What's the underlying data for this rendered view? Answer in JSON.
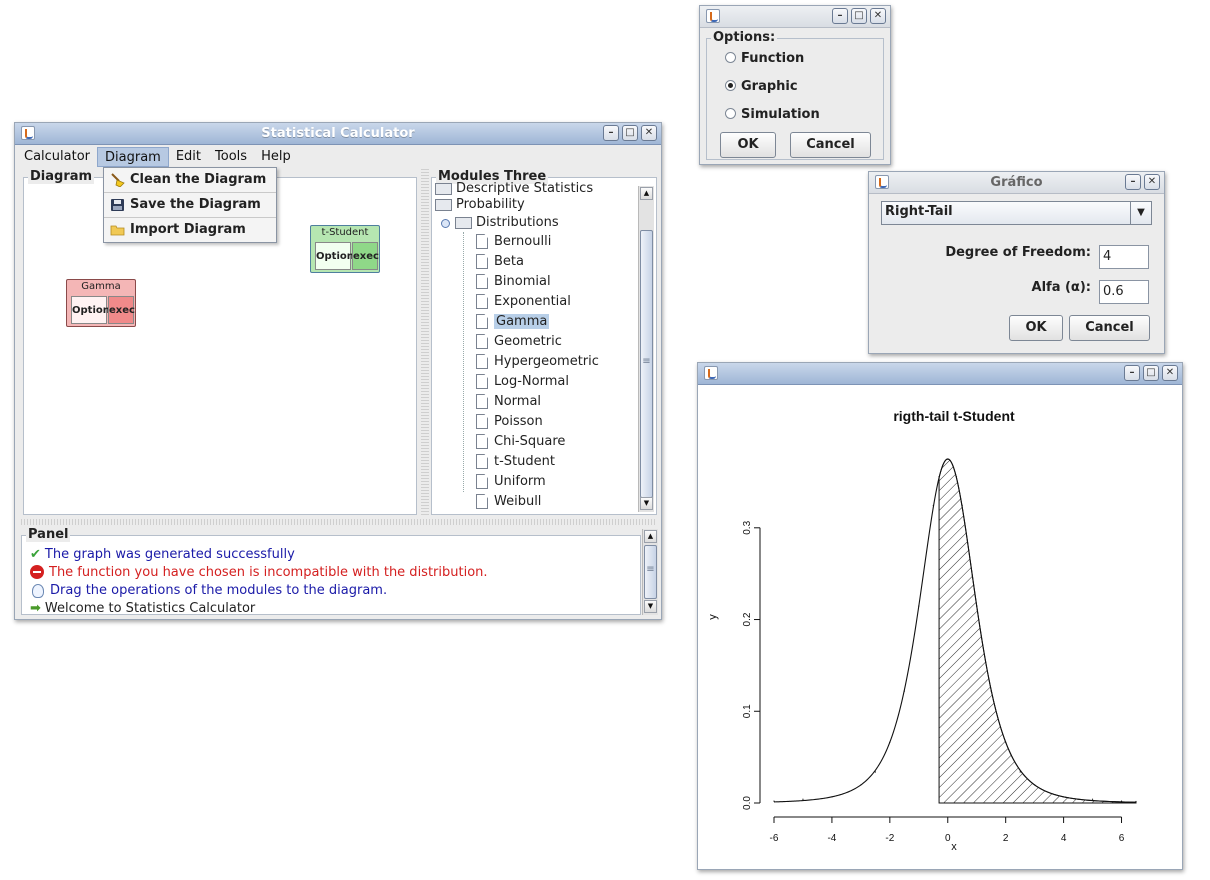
{
  "main_window": {
    "title": "Statistical Calculator",
    "menus": [
      "Calculator",
      "Diagram",
      "Edit",
      "Tools",
      "Help"
    ],
    "active_menu": "Diagram",
    "diagram_menu_items": [
      {
        "label": "Clean the Diagram",
        "icon": "broom-icon"
      },
      {
        "label": "Save the Diagram",
        "icon": "floppy-disk-icon"
      },
      {
        "label": "Import Diagram",
        "icon": "folder-icon"
      }
    ],
    "diagram_panel_title": "Diagram",
    "nodes": [
      {
        "title": "t-Student",
        "option_label": "Option",
        "exec_label": "exec",
        "color": "#b6e6b1"
      },
      {
        "title": "Gamma",
        "option_label": "Option",
        "exec_label": "exec",
        "color": "#f4b6b6"
      }
    ],
    "modules_title": "Modules Three",
    "tree": {
      "partial_item": "Descriptive Statistics",
      "probability": "Probability",
      "distributions": "Distributions",
      "items": [
        "Bernoulli",
        "Beta",
        "Binomial",
        "Exponential",
        "Gamma",
        "Geometric",
        "Hypergeometric",
        "Log-Normal",
        "Normal",
        "Poisson",
        "Chi-Square",
        "t-Student",
        "Uniform",
        "Weibull"
      ],
      "selected": "Gamma"
    },
    "panel_title": "Panel",
    "messages": [
      {
        "text": "The graph was generated successfully",
        "color": "#1a1aa8",
        "icon": "check-icon"
      },
      {
        "text": "The function you have chosen is incompatible with the distribution.",
        "color": "#d42020",
        "icon": "error-icon"
      },
      {
        "text": "Drag the operations of the modules to the diagram.",
        "color": "#1a1aa8",
        "icon": "lightbulb-icon"
      },
      {
        "text": "Welcome to Statistics Calculator",
        "color": "#222222",
        "icon": "arrow-right-icon"
      }
    ]
  },
  "options_dialog": {
    "group_title": "Options:",
    "radios": [
      "Function",
      "Graphic",
      "Simulation"
    ],
    "selected": "Graphic",
    "ok": "OK",
    "cancel": "Cancel"
  },
  "grafico_dialog": {
    "title": "Gráfico",
    "tail_select": "Right-Tail",
    "dof_label": "Degree of Freedom:",
    "dof_value": "4",
    "alpha_label": "Alfa (α):",
    "alpha_value": "0.6",
    "ok": "OK",
    "cancel": "Cancel"
  },
  "chart_data": {
    "type": "line",
    "title": "rigth-tail t-Student",
    "xlabel": "x",
    "ylabel": "y",
    "xlim": [
      -6,
      6.5
    ],
    "ylim": [
      0,
      0.375
    ],
    "xticks": [
      "-6",
      "-4",
      "-2",
      "0",
      "2",
      "4",
      "6"
    ],
    "yticks": [
      "0.0",
      "0.1",
      "0.2",
      "0.3"
    ],
    "distribution": "t-Student",
    "degrees_of_freedom": 4,
    "shaded_from_x": -0.3,
    "shading": "hatched",
    "x": [
      -6.0,
      -5.0,
      -4.0,
      -3.0,
      -2.5,
      -2.0,
      -1.5,
      -1.0,
      -0.5,
      -0.3,
      0.0,
      0.3,
      0.5,
      1.0,
      1.5,
      2.0,
      2.5,
      3.0,
      4.0,
      5.0,
      6.0,
      6.5
    ],
    "y": [
      0.0021,
      0.0041,
      0.0066,
      0.0197,
      0.0338,
      0.0663,
      0.122,
      0.2147,
      0.3244,
      0.3557,
      0.375,
      0.3557,
      0.3244,
      0.2147,
      0.122,
      0.0663,
      0.0338,
      0.0197,
      0.0066,
      0.0041,
      0.0021,
      0.0016
    ]
  }
}
